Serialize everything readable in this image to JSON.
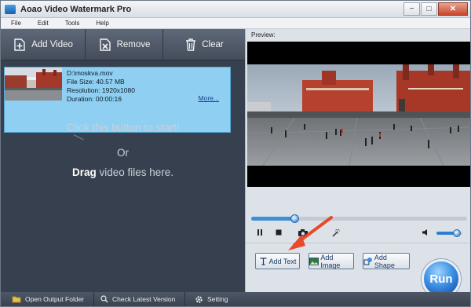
{
  "window": {
    "title": "Aoao Video Watermark Pro",
    "minimize": "−",
    "maximize": "□",
    "close": "✕"
  },
  "menu": [
    "File",
    "Edit",
    "Tools",
    "Help"
  ],
  "toolbar": {
    "add_video": "Add Video",
    "remove": "Remove",
    "clear": "Clear"
  },
  "video_item": {
    "path": "D:\\moskva.mov",
    "file_size": "File Size: 40.57 MB",
    "resolution": "Resolution: 1920x1080",
    "duration": "Duration: 00:00:16",
    "more": "More..."
  },
  "hints": {
    "line1": "Click this button to start!",
    "line2": "Or",
    "line3_bold": "Drag",
    "line3_rest": " video files here."
  },
  "statusbar": {
    "open_output": "Open Output Folder",
    "check_version": "Check Latest Version",
    "setting": "Setting"
  },
  "preview": {
    "label": "Preview:",
    "progress": 0.2,
    "volume": 0.8
  },
  "actions": {
    "add_text": "Add Text",
    "add_image": "Add Image",
    "add_shape": "Add Shape",
    "run": "Run"
  },
  "colors": {
    "left_panel": "#37404e",
    "selection": "#8fd0f2",
    "accent": "#3b8ed8",
    "arrow": "#e8492a"
  }
}
